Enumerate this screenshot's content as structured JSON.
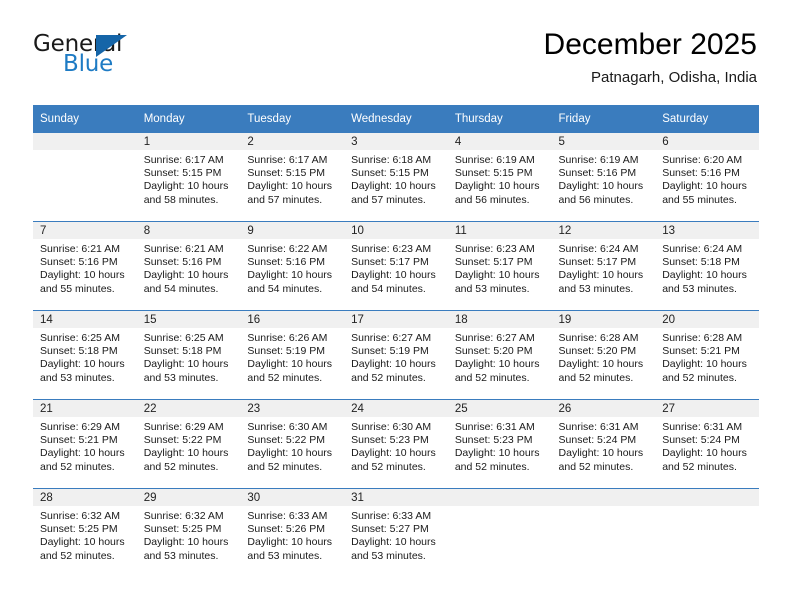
{
  "brand": {
    "name_part1": "General",
    "name_part2": "Blue",
    "triangle_color": "#1565a8",
    "blue_color": "#1e7bc4"
  },
  "header": {
    "title": "December 2025",
    "subtitle": "Patnagarh, Odisha, India"
  },
  "theme": {
    "header_blue": "#3a7cbe",
    "daynum_band": "#f0f0f0"
  },
  "calendar": {
    "weekdays": [
      "Sunday",
      "Monday",
      "Tuesday",
      "Wednesday",
      "Thursday",
      "Friday",
      "Saturday"
    ],
    "weeks": [
      [
        {
          "day": "",
          "sunrise": "",
          "sunset": "",
          "daylight_line1": "",
          "daylight_line2": ""
        },
        {
          "day": "1",
          "sunrise": "Sunrise: 6:17 AM",
          "sunset": "Sunset: 5:15 PM",
          "daylight_line1": "Daylight: 10 hours",
          "daylight_line2": "and 58 minutes."
        },
        {
          "day": "2",
          "sunrise": "Sunrise: 6:17 AM",
          "sunset": "Sunset: 5:15 PM",
          "daylight_line1": "Daylight: 10 hours",
          "daylight_line2": "and 57 minutes."
        },
        {
          "day": "3",
          "sunrise": "Sunrise: 6:18 AM",
          "sunset": "Sunset: 5:15 PM",
          "daylight_line1": "Daylight: 10 hours",
          "daylight_line2": "and 57 minutes."
        },
        {
          "day": "4",
          "sunrise": "Sunrise: 6:19 AM",
          "sunset": "Sunset: 5:15 PM",
          "daylight_line1": "Daylight: 10 hours",
          "daylight_line2": "and 56 minutes."
        },
        {
          "day": "5",
          "sunrise": "Sunrise: 6:19 AM",
          "sunset": "Sunset: 5:16 PM",
          "daylight_line1": "Daylight: 10 hours",
          "daylight_line2": "and 56 minutes."
        },
        {
          "day": "6",
          "sunrise": "Sunrise: 6:20 AM",
          "sunset": "Sunset: 5:16 PM",
          "daylight_line1": "Daylight: 10 hours",
          "daylight_line2": "and 55 minutes."
        }
      ],
      [
        {
          "day": "7",
          "sunrise": "Sunrise: 6:21 AM",
          "sunset": "Sunset: 5:16 PM",
          "daylight_line1": "Daylight: 10 hours",
          "daylight_line2": "and 55 minutes."
        },
        {
          "day": "8",
          "sunrise": "Sunrise: 6:21 AM",
          "sunset": "Sunset: 5:16 PM",
          "daylight_line1": "Daylight: 10 hours",
          "daylight_line2": "and 54 minutes."
        },
        {
          "day": "9",
          "sunrise": "Sunrise: 6:22 AM",
          "sunset": "Sunset: 5:16 PM",
          "daylight_line1": "Daylight: 10 hours",
          "daylight_line2": "and 54 minutes."
        },
        {
          "day": "10",
          "sunrise": "Sunrise: 6:23 AM",
          "sunset": "Sunset: 5:17 PM",
          "daylight_line1": "Daylight: 10 hours",
          "daylight_line2": "and 54 minutes."
        },
        {
          "day": "11",
          "sunrise": "Sunrise: 6:23 AM",
          "sunset": "Sunset: 5:17 PM",
          "daylight_line1": "Daylight: 10 hours",
          "daylight_line2": "and 53 minutes."
        },
        {
          "day": "12",
          "sunrise": "Sunrise: 6:24 AM",
          "sunset": "Sunset: 5:17 PM",
          "daylight_line1": "Daylight: 10 hours",
          "daylight_line2": "and 53 minutes."
        },
        {
          "day": "13",
          "sunrise": "Sunrise: 6:24 AM",
          "sunset": "Sunset: 5:18 PM",
          "daylight_line1": "Daylight: 10 hours",
          "daylight_line2": "and 53 minutes."
        }
      ],
      [
        {
          "day": "14",
          "sunrise": "Sunrise: 6:25 AM",
          "sunset": "Sunset: 5:18 PM",
          "daylight_line1": "Daylight: 10 hours",
          "daylight_line2": "and 53 minutes."
        },
        {
          "day": "15",
          "sunrise": "Sunrise: 6:25 AM",
          "sunset": "Sunset: 5:18 PM",
          "daylight_line1": "Daylight: 10 hours",
          "daylight_line2": "and 53 minutes."
        },
        {
          "day": "16",
          "sunrise": "Sunrise: 6:26 AM",
          "sunset": "Sunset: 5:19 PM",
          "daylight_line1": "Daylight: 10 hours",
          "daylight_line2": "and 52 minutes."
        },
        {
          "day": "17",
          "sunrise": "Sunrise: 6:27 AM",
          "sunset": "Sunset: 5:19 PM",
          "daylight_line1": "Daylight: 10 hours",
          "daylight_line2": "and 52 minutes."
        },
        {
          "day": "18",
          "sunrise": "Sunrise: 6:27 AM",
          "sunset": "Sunset: 5:20 PM",
          "daylight_line1": "Daylight: 10 hours",
          "daylight_line2": "and 52 minutes."
        },
        {
          "day": "19",
          "sunrise": "Sunrise: 6:28 AM",
          "sunset": "Sunset: 5:20 PM",
          "daylight_line1": "Daylight: 10 hours",
          "daylight_line2": "and 52 minutes."
        },
        {
          "day": "20",
          "sunrise": "Sunrise: 6:28 AM",
          "sunset": "Sunset: 5:21 PM",
          "daylight_line1": "Daylight: 10 hours",
          "daylight_line2": "and 52 minutes."
        }
      ],
      [
        {
          "day": "21",
          "sunrise": "Sunrise: 6:29 AM",
          "sunset": "Sunset: 5:21 PM",
          "daylight_line1": "Daylight: 10 hours",
          "daylight_line2": "and 52 minutes."
        },
        {
          "day": "22",
          "sunrise": "Sunrise: 6:29 AM",
          "sunset": "Sunset: 5:22 PM",
          "daylight_line1": "Daylight: 10 hours",
          "daylight_line2": "and 52 minutes."
        },
        {
          "day": "23",
          "sunrise": "Sunrise: 6:30 AM",
          "sunset": "Sunset: 5:22 PM",
          "daylight_line1": "Daylight: 10 hours",
          "daylight_line2": "and 52 minutes."
        },
        {
          "day": "24",
          "sunrise": "Sunrise: 6:30 AM",
          "sunset": "Sunset: 5:23 PM",
          "daylight_line1": "Daylight: 10 hours",
          "daylight_line2": "and 52 minutes."
        },
        {
          "day": "25",
          "sunrise": "Sunrise: 6:31 AM",
          "sunset": "Sunset: 5:23 PM",
          "daylight_line1": "Daylight: 10 hours",
          "daylight_line2": "and 52 minutes."
        },
        {
          "day": "26",
          "sunrise": "Sunrise: 6:31 AM",
          "sunset": "Sunset: 5:24 PM",
          "daylight_line1": "Daylight: 10 hours",
          "daylight_line2": "and 52 minutes."
        },
        {
          "day": "27",
          "sunrise": "Sunrise: 6:31 AM",
          "sunset": "Sunset: 5:24 PM",
          "daylight_line1": "Daylight: 10 hours",
          "daylight_line2": "and 52 minutes."
        }
      ],
      [
        {
          "day": "28",
          "sunrise": "Sunrise: 6:32 AM",
          "sunset": "Sunset: 5:25 PM",
          "daylight_line1": "Daylight: 10 hours",
          "daylight_line2": "and 52 minutes."
        },
        {
          "day": "29",
          "sunrise": "Sunrise: 6:32 AM",
          "sunset": "Sunset: 5:25 PM",
          "daylight_line1": "Daylight: 10 hours",
          "daylight_line2": "and 53 minutes."
        },
        {
          "day": "30",
          "sunrise": "Sunrise: 6:33 AM",
          "sunset": "Sunset: 5:26 PM",
          "daylight_line1": "Daylight: 10 hours",
          "daylight_line2": "and 53 minutes."
        },
        {
          "day": "31",
          "sunrise": "Sunrise: 6:33 AM",
          "sunset": "Sunset: 5:27 PM",
          "daylight_line1": "Daylight: 10 hours",
          "daylight_line2": "and 53 minutes."
        },
        {
          "day": "",
          "sunrise": "",
          "sunset": "",
          "daylight_line1": "",
          "daylight_line2": ""
        },
        {
          "day": "",
          "sunrise": "",
          "sunset": "",
          "daylight_line1": "",
          "daylight_line2": ""
        },
        {
          "day": "",
          "sunrise": "",
          "sunset": "",
          "daylight_line1": "",
          "daylight_line2": ""
        }
      ]
    ]
  }
}
